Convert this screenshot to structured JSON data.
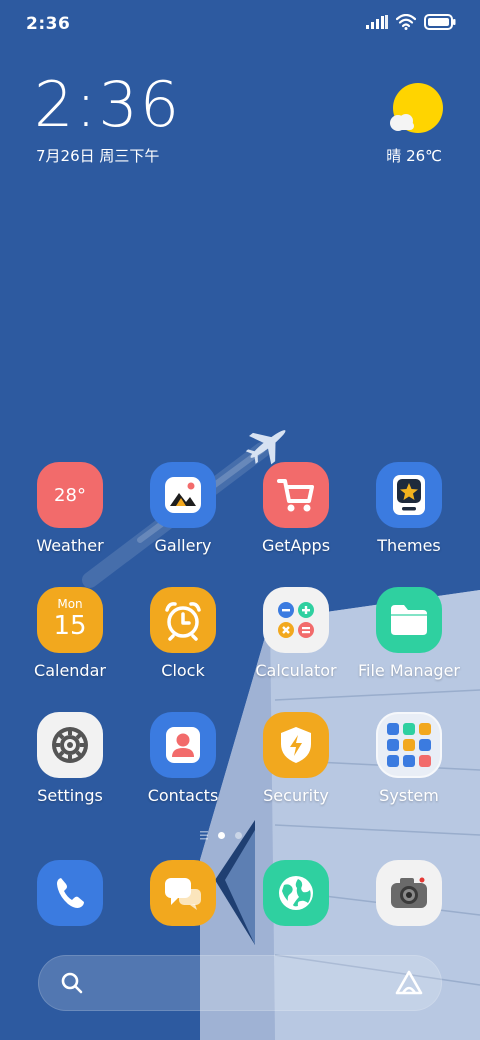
{
  "status_bar": {
    "time": "2:36",
    "signal_icon": "signal-bars-icon",
    "wifi_icon": "wifi-icon",
    "battery_icon": "battery-icon"
  },
  "clock_widget": {
    "time": "2:36",
    "date": "7月26日 周三下午"
  },
  "weather_widget": {
    "icon": "sun-cloud-icon",
    "summary": "晴 26℃"
  },
  "apps": [
    {
      "label": "Weather",
      "icon": "weather-icon",
      "icon_text": "28°",
      "color": "#f26b6b"
    },
    {
      "label": "Gallery",
      "icon": "gallery-icon",
      "color": "#3b7be0"
    },
    {
      "label": "GetApps",
      "icon": "shopping-cart-icon",
      "color": "#f26b6b"
    },
    {
      "label": "Themes",
      "icon": "themes-icon",
      "color": "#3b7be0"
    },
    {
      "label": "Calendar",
      "icon": "calendar-icon",
      "icon_day": "Mon",
      "icon_date": "15",
      "color": "#f2a81e"
    },
    {
      "label": "Clock",
      "icon": "alarm-clock-icon",
      "color": "#f2a81e"
    },
    {
      "label": "Calculator",
      "icon": "calculator-icon",
      "color": "#f2f2f2"
    },
    {
      "label": "File Manager",
      "icon": "folder-icon",
      "color": "#2fd0a0"
    },
    {
      "label": "Settings",
      "icon": "gear-icon",
      "color": "#f2f2f2"
    },
    {
      "label": "Contacts",
      "icon": "contacts-icon",
      "color": "#3b7be0"
    },
    {
      "label": "Security",
      "icon": "shield-icon",
      "color": "#f2a81e"
    },
    {
      "label": "System",
      "icon": "folder-grid-icon",
      "color": "#e9eef6"
    }
  ],
  "page_indicator": {
    "pages": 2,
    "current": 1
  },
  "dock": [
    {
      "name": "phone",
      "icon": "phone-icon",
      "color": "#3b7be0"
    },
    {
      "name": "messages",
      "icon": "message-bubble-icon",
      "color": "#f2a81e"
    },
    {
      "name": "browser",
      "icon": "globe-icon",
      "color": "#2fd0a0"
    },
    {
      "name": "camera",
      "icon": "camera-icon",
      "color": "#f2f2f2"
    }
  ],
  "search": {
    "search_icon": "search-icon",
    "assistant_icon": "assistant-icon"
  }
}
